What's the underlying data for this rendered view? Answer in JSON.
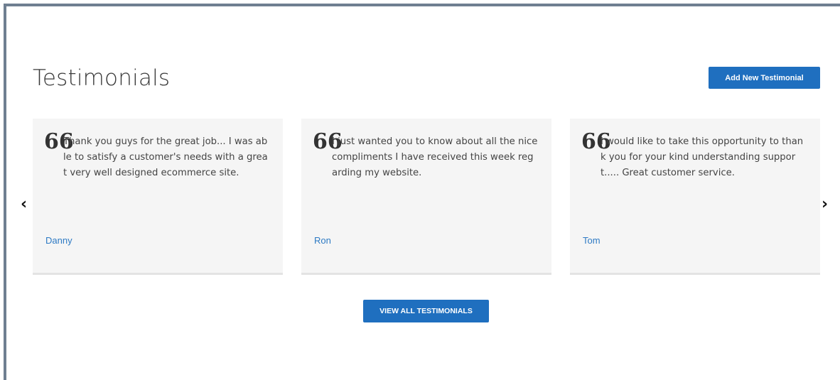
{
  "header": {
    "title": "Testimonials",
    "add_button_label": "Add New Testimonial"
  },
  "carousel": {
    "prev_icon": "chevron-left-icon",
    "next_icon": "chevron-right-icon",
    "prev_glyph": "‹",
    "next_glyph": "›",
    "quote_glyph": "66",
    "items": [
      {
        "text": "Thank you guys for the great job... I was able to satisfy a customer's needs with a great very well designed ecommerce site.",
        "author": "Danny"
      },
      {
        "text": "I just wanted you to know about all the nice compliments I have received this week regarding my website.",
        "author": "Ron"
      },
      {
        "text": "I would like to take this opportunity to thank you for your kind understanding support..... Great customer service.",
        "author": "Tom"
      }
    ]
  },
  "footer": {
    "view_all_label": "VIEW ALL TESTIMONIALS"
  },
  "colors": {
    "accent": "#1f6fbf",
    "author_link": "#2d7ac4",
    "card_bg": "#f5f5f5",
    "frame_border": "#6f7f91"
  }
}
